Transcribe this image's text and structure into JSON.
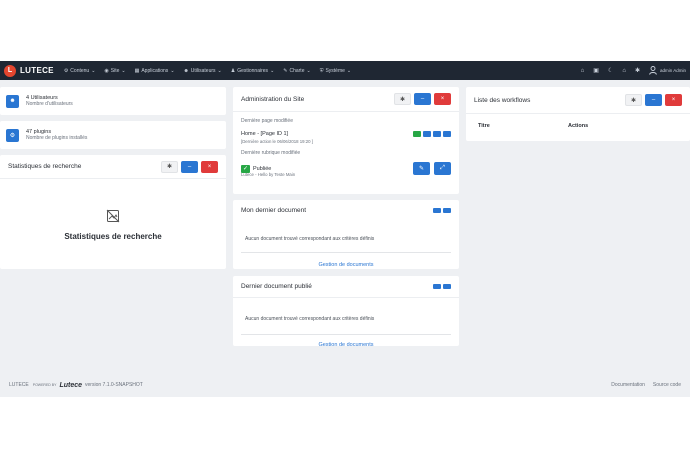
{
  "navbar": {
    "logo_text": "LUTECE",
    "items": [
      {
        "label": "Contenu",
        "icon": "content-icon"
      },
      {
        "label": "Site",
        "icon": "site-icon"
      },
      {
        "label": "Applications",
        "icon": "applications-icon"
      },
      {
        "label": "Utilisateurs",
        "icon": "users-icon"
      },
      {
        "label": "Gestionnaires",
        "icon": "managers-icon"
      },
      {
        "label": "Charte",
        "icon": "brush-icon"
      },
      {
        "label": "Système",
        "icon": "system-icon"
      }
    ],
    "user_label": "admin Admin"
  },
  "stats": {
    "users": {
      "value": "4 Utilisateurs",
      "label": "Nombre d'utilisateurs"
    },
    "plugins": {
      "value": "47 plugins",
      "label": "Nombre de plugins installés"
    }
  },
  "search_stats": {
    "title": "Statistiques de recherche",
    "empty_title": "Statistiques de recherche"
  },
  "site_admin": {
    "title": "Administration du Site",
    "last_page_label": "Dernière page modifiée",
    "last_page_name": "Home - [Page ID 1]",
    "last_page_date": "[Dernière action le 06/06/2018 19:20 ]",
    "last_rubric_label": "Dernière rubrique modifiée",
    "published_label": "Publiée",
    "rubric_sub": "Lutece - Hello by Teste Main"
  },
  "my_last_doc": {
    "title": "Mon dernier document",
    "message": "Aucun document trouvé correspondant aux critères définis",
    "link": "Gestion de documents"
  },
  "last_published_doc": {
    "title": "Dernier document publié",
    "message": "Aucun document trouvé correspondant aux critères définis",
    "link": "Gestion de documents"
  },
  "workflows": {
    "title": "Liste des workflows",
    "columns": [
      "Titre",
      "Actions"
    ]
  },
  "footer": {
    "left_text": "LUTECE",
    "powered": "POWERED BY",
    "brand": "Lutece",
    "version": "version 7.1.0-SNAPSHOT",
    "links": [
      "Documentation",
      "Source code"
    ]
  },
  "colors": {
    "navbar_bg": "#1f2733",
    "accent_blue": "#2a76d2",
    "danger_red": "#e03b3b",
    "success_green": "#27a745",
    "logo_red": "#e5462f"
  }
}
